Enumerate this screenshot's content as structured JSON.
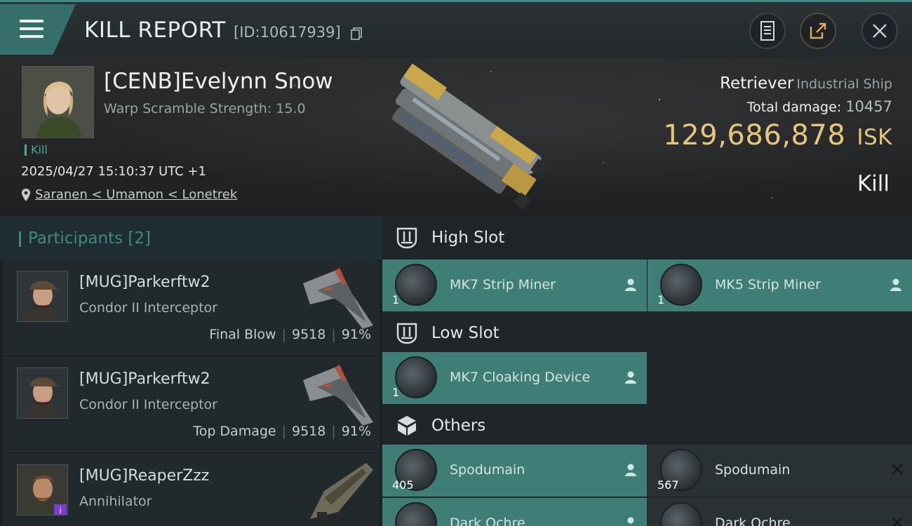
{
  "header": {
    "title": "KILL REPORT",
    "report_id": "[ID:10617939]"
  },
  "victim": {
    "name": "[CENB]Evelynn Snow",
    "subtitle": "Warp Scramble Strength: 15.0",
    "tag": "Kill",
    "timestamp": "2025/04/27 15:10:37 UTC +1",
    "location": "Saranen < Umamon < Lonetrek",
    "ship_name": "Retriever",
    "ship_class": "Industrial Ship",
    "total_damage_label": "Total damage:",
    "total_damage": "10457",
    "isk_value": "129,686,878",
    "isk_unit": "ISK",
    "result": "Kill"
  },
  "participants": {
    "header": "Participants [2]",
    "rows": [
      {
        "name": "[MUG]Parkerftw2",
        "ship": "Condor II Interceptor",
        "role": "Final Blow",
        "damage": "9518",
        "percent": "91%"
      },
      {
        "name": "[MUG]Parkerftw2",
        "ship": "Condor II Interceptor",
        "role": "Top Damage",
        "damage": "9518",
        "percent": "91%"
      },
      {
        "name": "[MUG]ReaperZzz",
        "ship": "Annihilator",
        "badge": "i"
      }
    ]
  },
  "fitting": {
    "high_slot": {
      "label": "High Slot",
      "modules": [
        {
          "name": "MK7 Strip Miner",
          "qty": "1"
        },
        {
          "name": "MK5 Strip Miner",
          "qty": "1"
        }
      ]
    },
    "low_slot": {
      "label": "Low Slot",
      "modules": [
        {
          "name": "MK7 Cloaking Device",
          "qty": "1"
        }
      ]
    },
    "others": {
      "label": "Others",
      "modules": [
        {
          "name": "Spodumain",
          "qty": "405"
        },
        {
          "name": "Spodumain",
          "qty": "567"
        },
        {
          "name": "Dark Ochre",
          "qty": ""
        },
        {
          "name": "Dark Ochre",
          "qty": ""
        }
      ]
    }
  },
  "colors": {
    "accent": "#3f8a84",
    "isk": "#e7c57a",
    "module_bg": "#3f7d77",
    "badge": "#7b3bd0"
  }
}
